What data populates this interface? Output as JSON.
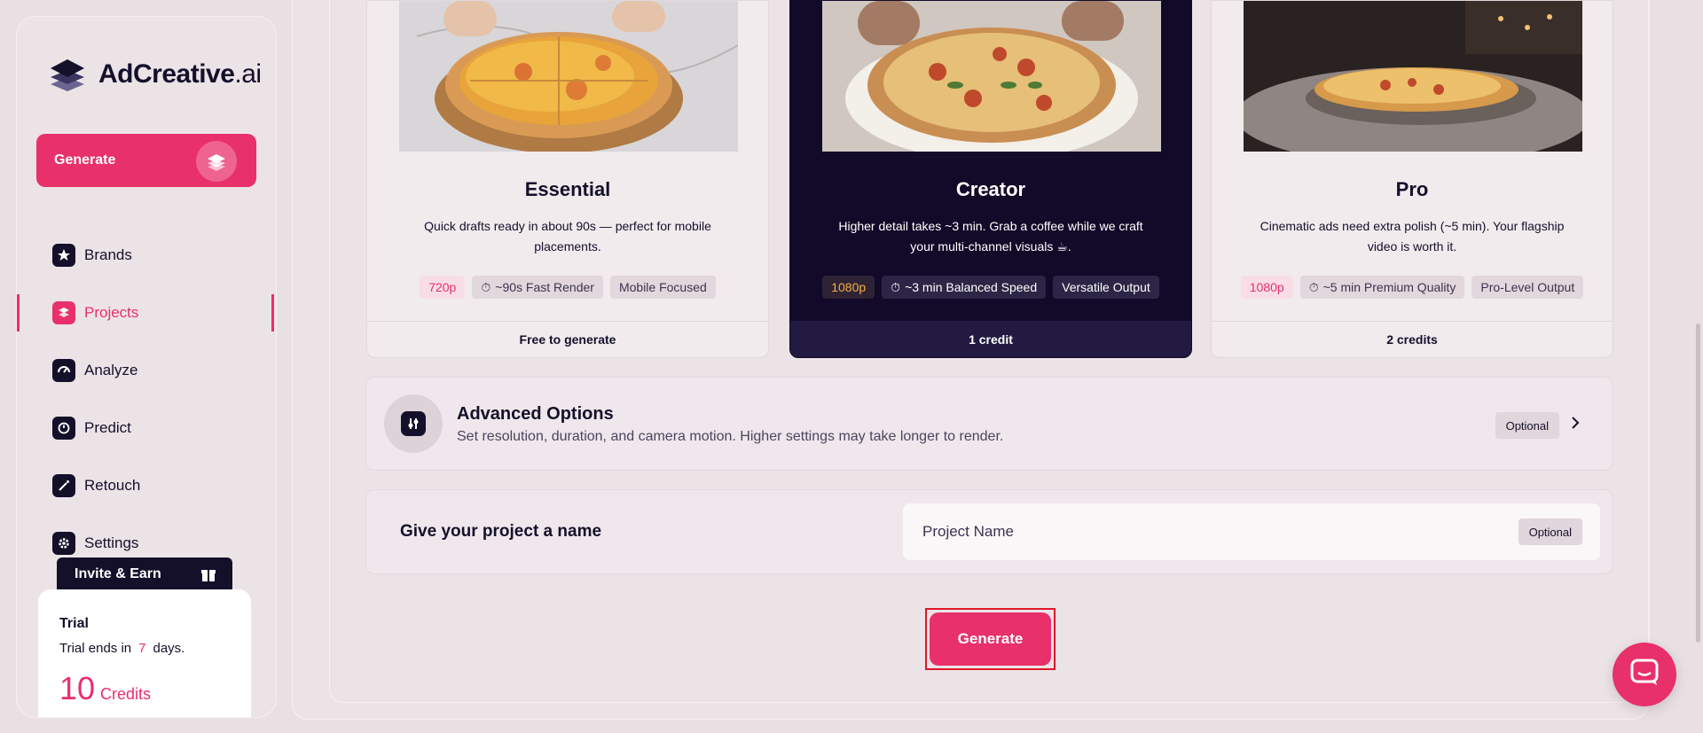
{
  "sidebar": {
    "logo": {
      "brand": "AdCreative",
      "suffix": ".ai"
    },
    "generate_label": "Generate",
    "items": [
      {
        "label": "Brands",
        "icon": "star-icon"
      },
      {
        "label": "Projects",
        "icon": "layers-icon",
        "active": true
      },
      {
        "label": "Analyze",
        "icon": "analyze-icon"
      },
      {
        "label": "Predict",
        "icon": "predict-icon"
      },
      {
        "label": "Retouch",
        "icon": "wand-icon"
      },
      {
        "label": "Settings",
        "icon": "gear-icon"
      }
    ],
    "invite_label": "Invite & Earn",
    "trial": {
      "title": "Trial",
      "ends_prefix": "Trial ends in",
      "days": "7",
      "ends_suffix": "days.",
      "credits_count": "10",
      "credits_label": "Credits"
    }
  },
  "plans": [
    {
      "name": "Essential",
      "description": "Quick drafts ready in about 90s — perfect for mobile placements.",
      "resolution": "720p",
      "speed": "~90s Fast Render",
      "feature": "Mobile Focused",
      "cost": "Free to generate"
    },
    {
      "name": "Creator",
      "description": "Higher detail takes ~3 min. Grab a coffee while we craft your multi-channel visuals ☕.",
      "resolution": "1080p",
      "speed": "~3 min Balanced Speed",
      "feature": "Versatile Output",
      "cost": "1 credit",
      "selected": true
    },
    {
      "name": "Pro",
      "description": "Cinematic ads need extra polish (~5 min). Your flagship video is worth it.",
      "resolution": "1080p",
      "speed": "~5 min Premium Quality",
      "feature": "Pro-Level Output",
      "cost": "2 credits"
    }
  ],
  "advanced": {
    "title": "Advanced Options",
    "subtitle": "Set resolution, duration, and camera motion. Higher settings may take longer to render.",
    "badge": "Optional"
  },
  "project_name": {
    "label": "Give your project a name",
    "placeholder": "Project Name",
    "badge": "Optional"
  },
  "generate_button": "Generate",
  "colors": {
    "accent": "#e8306a",
    "dark": "#120a28",
    "highlight": "#e0162b"
  }
}
